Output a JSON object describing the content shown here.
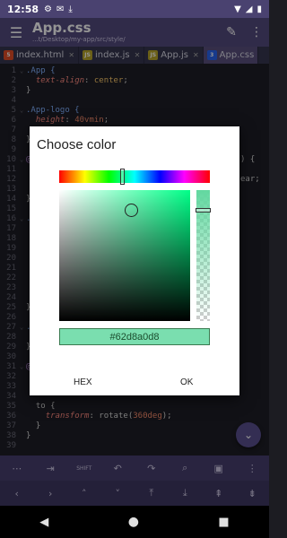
{
  "status": {
    "time": "12:58",
    "left_icons": [
      "gear-icon",
      "mail-icon",
      "download-icon"
    ],
    "right_icons": [
      "wifi-icon",
      "signal-icon",
      "battery-icon"
    ]
  },
  "appbar": {
    "title": "App.css",
    "path": "...t/Desktop/my-app/src/style/",
    "icons": [
      "menu-icon",
      "pencil-icon",
      "more-vert-icon"
    ]
  },
  "tabs": [
    {
      "label": "index.html",
      "badge": "5",
      "badge_color": "#e34c26",
      "active": false
    },
    {
      "label": "index.js",
      "badge": "JS",
      "badge_color": "#b8a52a",
      "active": false
    },
    {
      "label": "App.js",
      "badge": "JS",
      "badge_color": "#b8a52a",
      "active": false
    },
    {
      "label": "App.css",
      "badge": "3",
      "badge_color": "#2965f1",
      "active": true
    }
  ],
  "code": [
    {
      "n": "1",
      "fold": true,
      "parts": [
        {
          "t": ".App {",
          "c": "sel"
        }
      ]
    },
    {
      "n": "2",
      "parts": [
        {
          "t": "  "
        },
        {
          "t": "text-align",
          "c": "prop"
        },
        {
          "t": ": "
        },
        {
          "t": "center",
          "c": "val"
        },
        {
          "t": ";"
        }
      ]
    },
    {
      "n": "3",
      "parts": [
        {
          "t": "}"
        }
      ]
    },
    {
      "n": "4",
      "parts": []
    },
    {
      "n": "5",
      "fold": true,
      "parts": [
        {
          "t": ".App-logo {",
          "c": "sel"
        }
      ]
    },
    {
      "n": "6",
      "parts": [
        {
          "t": "  "
        },
        {
          "t": "height",
          "c": "prop"
        },
        {
          "t": ": "
        },
        {
          "t": "40vmin",
          "c": "num"
        },
        {
          "t": ";"
        }
      ]
    },
    {
      "n": "7",
      "parts": []
    },
    {
      "n": "8",
      "parts": [
        {
          "t": "}"
        }
      ]
    },
    {
      "n": "9",
      "parts": []
    },
    {
      "n": "10",
      "fold": true,
      "parts": [
        {
          "t": "@",
          "c": "key"
        }
      ]
    },
    {
      "n": "11",
      "parts": []
    },
    {
      "n": "12",
      "parts": []
    },
    {
      "n": "13",
      "parts": []
    },
    {
      "n": "14",
      "parts": [
        {
          "t": "}"
        }
      ]
    },
    {
      "n": "15",
      "parts": []
    },
    {
      "n": "16",
      "fold": true,
      "parts": [
        {
          "t": ".",
          "c": "sel"
        }
      ]
    },
    {
      "n": "17",
      "parts": []
    },
    {
      "n": "18",
      "parts": []
    },
    {
      "n": "19",
      "parts": []
    },
    {
      "n": "20",
      "parts": []
    },
    {
      "n": "21",
      "parts": []
    },
    {
      "n": "22",
      "parts": []
    },
    {
      "n": "23",
      "parts": []
    },
    {
      "n": "24",
      "parts": []
    },
    {
      "n": "25",
      "parts": [
        {
          "t": "}"
        }
      ]
    },
    {
      "n": "26",
      "parts": []
    },
    {
      "n": "27",
      "fold": true,
      "parts": [
        {
          "t": ".",
          "c": "sel"
        }
      ]
    },
    {
      "n": "28",
      "parts": []
    },
    {
      "n": "29",
      "parts": [
        {
          "t": "}"
        }
      ]
    },
    {
      "n": "30",
      "parts": []
    },
    {
      "n": "31",
      "fold": true,
      "parts": [
        {
          "t": "@",
          "c": "key"
        }
      ]
    },
    {
      "n": "32",
      "parts": []
    },
    {
      "n": "33",
      "parts": []
    },
    {
      "n": "34",
      "parts": []
    },
    {
      "n": "35",
      "parts": [
        {
          "t": "  to {"
        }
      ]
    },
    {
      "n": "36",
      "parts": [
        {
          "t": "    "
        },
        {
          "t": "transform",
          "c": "prop"
        },
        {
          "t": ": rotate("
        },
        {
          "t": "360deg",
          "c": "num"
        },
        {
          "t": ");"
        }
      ]
    },
    {
      "n": "37",
      "parts": [
        {
          "t": "  }"
        }
      ]
    },
    {
      "n": "38",
      "parts": [
        {
          "t": "}"
        }
      ]
    },
    {
      "n": "39",
      "parts": []
    }
  ],
  "right_fragments": [
    {
      "line": "10",
      "text": ") {"
    },
    {
      "line": "12",
      "text": "ear;"
    }
  ],
  "dialog": {
    "title": "Choose color",
    "hue_fraction": 0.421,
    "saturation": 0.55,
    "value": 0.85,
    "alpha": 0.847,
    "color": "#62d8a0",
    "hex_value": "#62d8a0d8",
    "hex_button": "HEX",
    "ok_button": "OK"
  },
  "toolbar1": [
    "more-horiz-icon",
    "tab-icon",
    "shift-key-icon",
    "undo-icon",
    "redo-icon",
    "search-icon",
    "save-icon",
    "more-vert-icon"
  ],
  "toolbar1_shift_label": "SHIFT",
  "toolbar2": [
    "arrow-left-icon",
    "arrow-right-icon",
    "arrow-up-icon",
    "arrow-down-icon",
    "line-up-icon",
    "line-down-icon",
    "page-up-icon",
    "page-down-icon"
  ],
  "navbar": [
    "back-icon",
    "home-icon",
    "recents-icon"
  ],
  "fab_icon": "chevron-down-icon"
}
